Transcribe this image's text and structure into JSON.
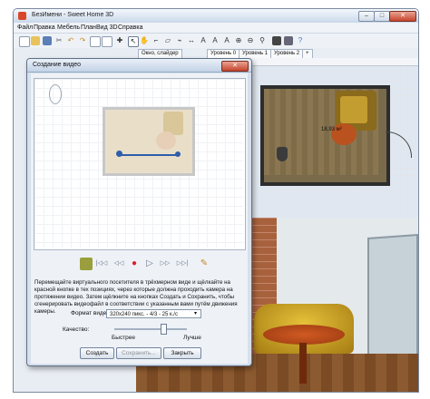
{
  "window": {
    "title": "БезИмени - Sweet Home 3D",
    "buttons": {
      "minimize": "–",
      "maximize": "□",
      "close": "✕"
    }
  },
  "menu": [
    "Файл",
    "Правка",
    "Мебель",
    "План",
    "Вид 3D",
    "Справка"
  ],
  "plan": {
    "tabs": [
      "Окно, слайдер",
      "Уровень 0",
      "Уровень 1",
      "Уровень 2",
      "+"
    ],
    "room_area": "18,93 м²"
  },
  "dialog": {
    "title": "Создание видео",
    "close": "✕",
    "controls": {
      "record": "●",
      "rewind_start": "|◁◁",
      "rewind": "◁◁",
      "play": "▷",
      "forward": "▷▷",
      "forward_end": "▷▷|"
    },
    "instruction": "Перемещайте виртуального посетителя в трёхмерном виде и щёлкайте на красной кнопке в тех позициях, через которые должна проходить камера на протяжении видео. Затем щёлкните на кнопках Создать и Сохранить, чтобы сгенерировать видеофайл в соответствии с указанным вами путём движения камеры.",
    "format_label": "Формат видео:",
    "format_value": "320x240 пикс. - 4/3 - 25 к./с",
    "quality_label": "Качество:",
    "quality_low": "Быстрее",
    "quality_high": "Лучше",
    "buttons": {
      "create": "Создать",
      "save": "Сохранить...",
      "close": "Закрыть"
    }
  },
  "colors": {
    "record": "#d8222a",
    "path": "#2f5ea8",
    "sofa": "#c9a023",
    "table": "#c24d1a"
  }
}
